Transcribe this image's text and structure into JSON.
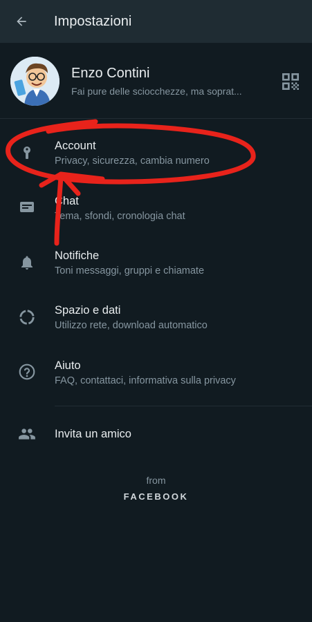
{
  "appbar": {
    "title": "Impostazioni",
    "back_icon": "arrow-left-icon"
  },
  "profile": {
    "name": "Enzo Contini",
    "status": "Fai pure delle sciocchezze, ma soprat...",
    "qr_icon": "qr-code-icon"
  },
  "menu": [
    {
      "title": "Account",
      "subtitle": "Privacy, sicurezza, cambia numero",
      "icon": "key-icon"
    },
    {
      "title": "Chat",
      "subtitle": "Tema, sfondi, cronologia chat",
      "icon": "chat-icon"
    },
    {
      "title": "Notifiche",
      "subtitle": "Toni messaggi, gruppi e chiamate",
      "icon": "bell-icon"
    },
    {
      "title": "Spazio e dati",
      "subtitle": "Utilizzo rete, download automatico",
      "icon": "data-usage-icon"
    },
    {
      "title": "Aiuto",
      "subtitle": "FAQ, contattaci, informativa sulla privacy",
      "icon": "help-icon"
    }
  ],
  "invite": {
    "title": "Invita un amico",
    "icon": "people-icon"
  },
  "footer": {
    "from": "from",
    "brand": "FACEBOOK"
  },
  "colors": {
    "background": "#111b21",
    "appbar": "#1f2c33",
    "primary_text": "#e9edef",
    "secondary_text": "#8696a0",
    "annotation": "#e8231b"
  }
}
